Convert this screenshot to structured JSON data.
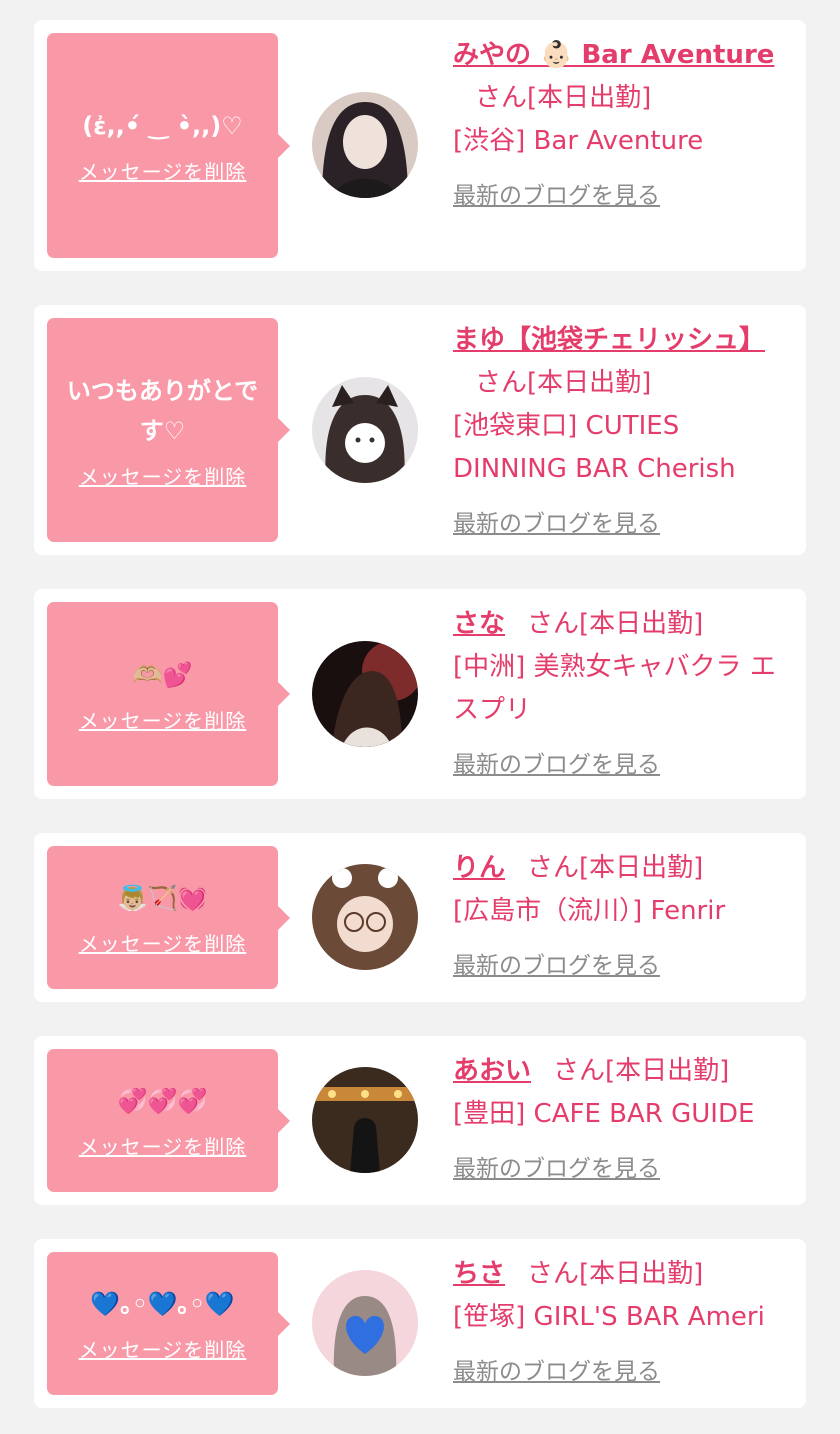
{
  "messages": [
    {
      "text": "(ἐ,,•́ ‿ •̀,,)♡",
      "delete_label": "メッセージを削除",
      "cast_name": "みやの 👶🏻 Bar Aventure",
      "honorific": "さん[本日出勤]",
      "shop": "[渋谷] Bar Aventure",
      "blog_label": "最新のブログを見る",
      "avatar_colors": [
        "#d9cbc4",
        "#2a2226"
      ]
    },
    {
      "text": "いつもありがとです♡",
      "delete_label": "メッセージを削除",
      "cast_name": "まゆ【池袋チェリッシュ】",
      "honorific": "さん[本日出勤]",
      "shop": "[池袋東口] CUTIES DINNING BAR Cherish",
      "blog_label": "最新のブログを見る",
      "avatar_colors": [
        "#e6e4e6",
        "#3a2e2c"
      ]
    },
    {
      "text": "🫶🏼💕",
      "delete_label": "メッセージを削除",
      "cast_name": "さな",
      "honorific": "さん[本日出勤]",
      "shop": "[中洲] 美熟女キャバクラ エスプリ",
      "blog_label": "最新のブログを見る",
      "avatar_colors": [
        "#1a0f0f",
        "#7d2b2b"
      ]
    },
    {
      "text": "👼🏼🏹💓",
      "delete_label": "メッセージを削除",
      "cast_name": "りん",
      "honorific": "さん[本日出勤]",
      "shop": "[広島市（流川）] Fenrir",
      "blog_label": "最新のブログを見る",
      "avatar_colors": [
        "#6b4a37",
        "#f2dccf"
      ]
    },
    {
      "text": "💞💞💞",
      "delete_label": "メッセージを削除",
      "cast_name": "あおい",
      "honorific": "さん[本日出勤]",
      "shop": "[豊田] CAFE BAR GUIDE",
      "blog_label": "最新のブログを見る",
      "avatar_colors": [
        "#3b2a1e",
        "#c9873a"
      ]
    },
    {
      "text": "💙｡◦💙｡◦💙",
      "delete_label": "メッセージを削除",
      "cast_name": "ちさ",
      "honorific": "さん[本日出勤]",
      "shop": "[笹塚] GIRL'S BAR Ameri",
      "blog_label": "最新のブログを見る",
      "avatar_colors": [
        "#f4d6dc",
        "#2f6fe0"
      ]
    }
  ],
  "colors": {
    "bubble": "#f999a8",
    "accent": "#e43d6b",
    "blog_link": "#8c8c8c",
    "page_bg": "#f2f2f2"
  }
}
